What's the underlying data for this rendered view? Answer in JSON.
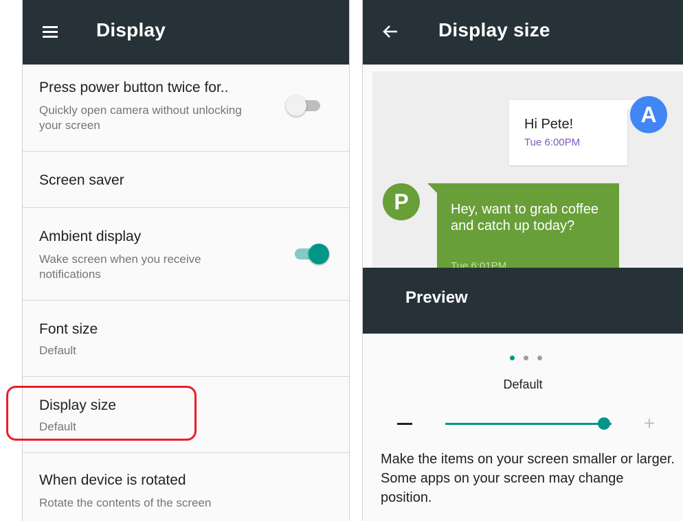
{
  "left": {
    "appbar": {
      "title": "Display",
      "menu_icon": "hamburger-menu-icon"
    },
    "prefs": [
      {
        "title": "Press power button twice for..",
        "summary": "Quickly open camera without unlocking your screen",
        "toggle": false
      },
      {
        "title": "Screen saver"
      },
      {
        "title": "Ambient display",
        "summary": "Wake screen when you receive notifications",
        "toggle": true
      },
      {
        "title": "Font size",
        "summary": "Default"
      },
      {
        "title": "Display size",
        "summary": "Default",
        "highlighted": true
      },
      {
        "title": "When device is rotated",
        "summary": "Rotate the contents of the screen"
      }
    ],
    "colors": {
      "appbar": "#263238",
      "toggle_on": "#009688",
      "highlight": "#ee1c25"
    }
  },
  "right": {
    "appbar": {
      "title": "Display size",
      "back_icon": "arrow-back-icon"
    },
    "preview": {
      "message_a": {
        "avatar": "A",
        "text": "Hi Pete!",
        "time": "Tue 6:00PM"
      },
      "message_p": {
        "avatar": "P",
        "text": "Hey, want to grab coffee and catch up today?",
        "time": "Tue 6:01PM"
      },
      "label": "Preview",
      "page_index": 0,
      "page_count": 3
    },
    "size_label": "Default",
    "slider": {
      "minus": "−",
      "plus": "+",
      "value_fraction": 0.92
    },
    "description": "Make the items on your screen smaller or larger. Some apps on your screen may change position.",
    "colors": {
      "accent": "#009688",
      "avatar_a": "#4285f4",
      "avatar_p": "#689f38"
    }
  }
}
